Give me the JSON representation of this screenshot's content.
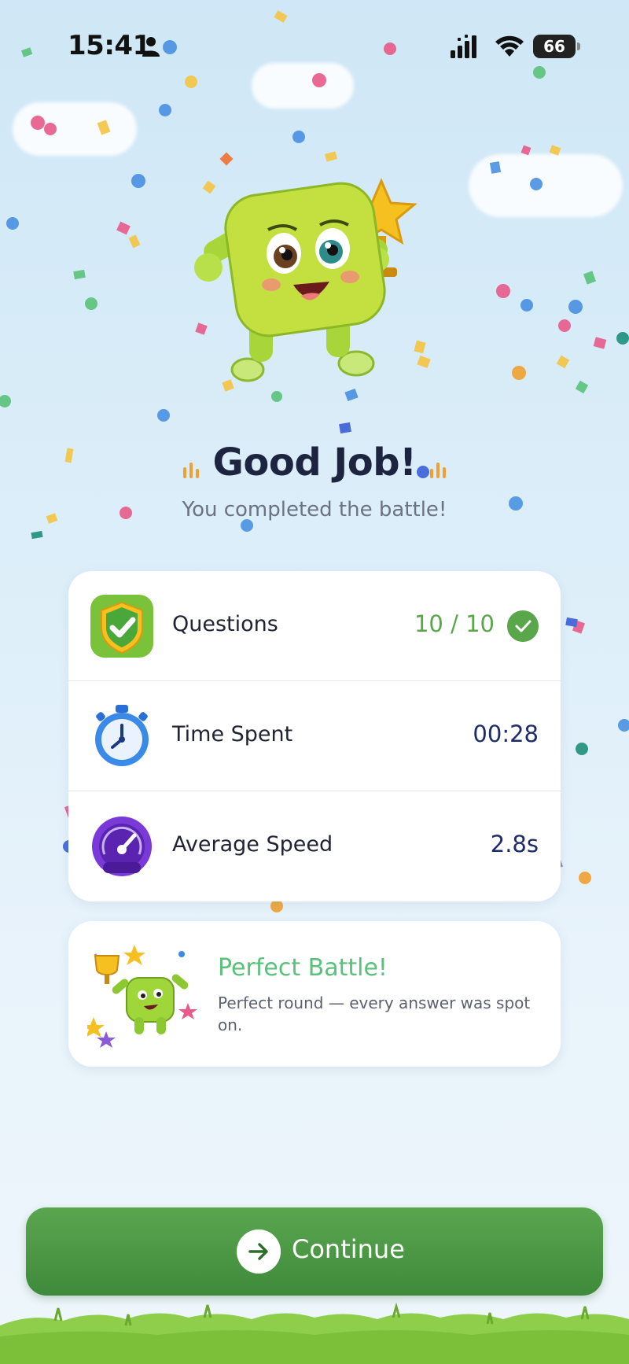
{
  "status_bar": {
    "time": "15:41",
    "battery": "66",
    "icons": [
      "person-icon",
      "signal-icon",
      "wifi-icon",
      "battery-icon"
    ]
  },
  "result": {
    "title": "Good Job!",
    "subtitle": "You completed the battle!"
  },
  "stats": [
    {
      "label": "Questions",
      "value": "10 / 10",
      "icon": "shield-check-icon"
    },
    {
      "label": "Time Spent",
      "value": "00:28",
      "icon": "stopwatch-icon"
    },
    {
      "label": "Average Speed",
      "value": "2.8s",
      "icon": "speedometer-icon"
    }
  ],
  "achievement": {
    "title": "Perfect Battle!",
    "description": "Perfect round — every answer was spot on."
  },
  "continue_button": {
    "label": "Continue",
    "icon": "arrow-right-icon"
  },
  "colors": {
    "accent_green": "#5aa64a",
    "button_green": "#4a9a45",
    "achievement_title": "#59c27a",
    "value_navy": "#1d2b6b",
    "title_dark": "#1c2440",
    "sky_top": "#cfe7f6"
  }
}
